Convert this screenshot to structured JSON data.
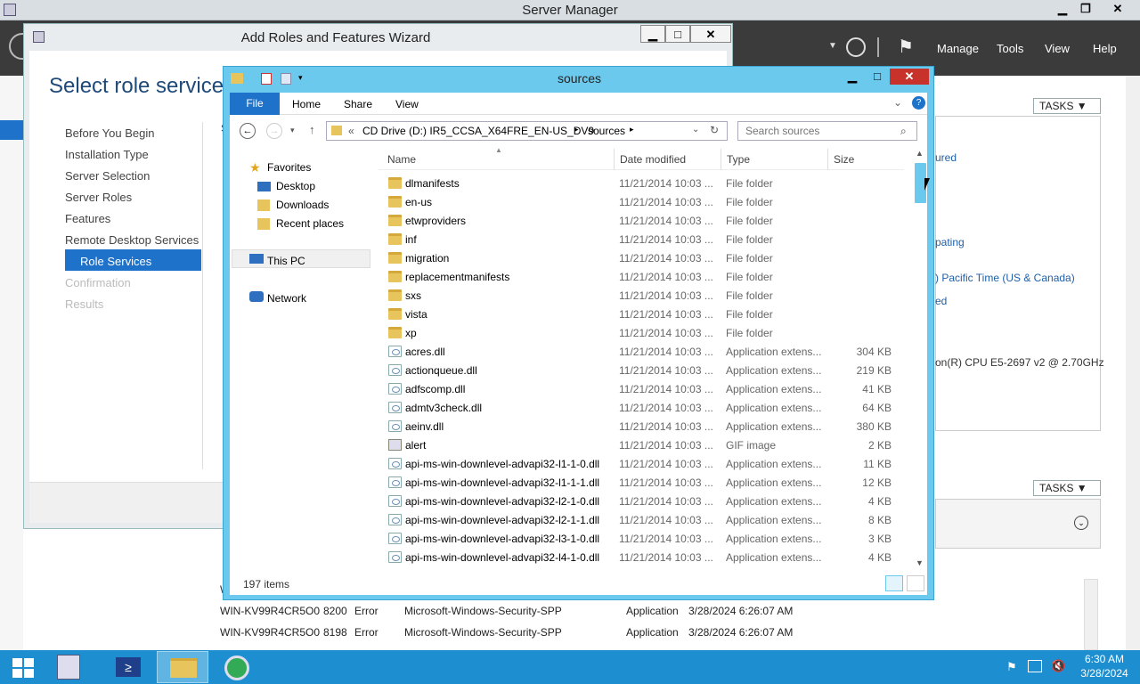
{
  "server_manager": {
    "title": "Server Manager",
    "menu": [
      "Manage",
      "Tools",
      "View",
      "Help"
    ],
    "tasks_label": "TASKS",
    "right_panel": {
      "links": [
        "ured",
        "pating",
        "ed",
        ") Pacific Time (US & Canada)"
      ],
      "cpu": "on(R) CPU E5-2697 v2 @ 2.70GHz"
    },
    "log_rows": [
      {
        "server": "WIN-KV99R4CR5O0",
        "id": "8200",
        "level": "Error",
        "source": "Microsoft-Windows-Security-SPP",
        "log": "Application",
        "time": "3/28/2024 6:26:07 AM"
      },
      {
        "server": "WIN-KV99R4CR5O0",
        "id": "8198",
        "level": "Error",
        "source": "Microsoft-Windows-Security-SPP",
        "log": "Application",
        "time": "3/28/2024 6:26:07 AM"
      }
    ],
    "partial_labels": {
      "s": "S",
      "w": "W"
    }
  },
  "wizard": {
    "title": "Add Roles and Features Wizard",
    "heading": "Select role services",
    "steps": [
      {
        "label": "Before You Begin",
        "state": "normal"
      },
      {
        "label": "Installation Type",
        "state": "normal"
      },
      {
        "label": "Server Selection",
        "state": "normal"
      },
      {
        "label": "Server Roles",
        "state": "normal"
      },
      {
        "label": "Features",
        "state": "normal"
      },
      {
        "label": "Remote Desktop Services",
        "state": "normal"
      },
      {
        "label": "Role Services",
        "state": "active"
      },
      {
        "label": "Confirmation",
        "state": "disabled"
      },
      {
        "label": "Results",
        "state": "disabled"
      }
    ]
  },
  "explorer": {
    "title": "sources",
    "ribbon_tabs": [
      "File",
      "Home",
      "Share",
      "View"
    ],
    "address": {
      "prefix": "«",
      "parts": [
        "CD Drive (D:) IR5_CCSA_X64FRE_EN-US_DV9",
        "sources"
      ]
    },
    "search_placeholder": "Search sources",
    "nav": {
      "favorites": "Favorites",
      "items": [
        "Desktop",
        "Downloads",
        "Recent places"
      ],
      "this_pc": "This PC",
      "network": "Network"
    },
    "columns": [
      "Name",
      "Date modified",
      "Type",
      "Size"
    ],
    "files": [
      {
        "name": "dlmanifests",
        "date": "11/21/2014 10:03 ...",
        "type": "File folder",
        "size": "",
        "kind": "folder"
      },
      {
        "name": "en-us",
        "date": "11/21/2014 10:03 ...",
        "type": "File folder",
        "size": "",
        "kind": "folder"
      },
      {
        "name": "etwproviders",
        "date": "11/21/2014 10:03 ...",
        "type": "File folder",
        "size": "",
        "kind": "folder"
      },
      {
        "name": "inf",
        "date": "11/21/2014 10:03 ...",
        "type": "File folder",
        "size": "",
        "kind": "folder"
      },
      {
        "name": "migration",
        "date": "11/21/2014 10:03 ...",
        "type": "File folder",
        "size": "",
        "kind": "folder"
      },
      {
        "name": "replacementmanifests",
        "date": "11/21/2014 10:03 ...",
        "type": "File folder",
        "size": "",
        "kind": "folder"
      },
      {
        "name": "sxs",
        "date": "11/21/2014 10:03 ...",
        "type": "File folder",
        "size": "",
        "kind": "folder"
      },
      {
        "name": "vista",
        "date": "11/21/2014 10:03 ...",
        "type": "File folder",
        "size": "",
        "kind": "folder"
      },
      {
        "name": "xp",
        "date": "11/21/2014 10:03 ...",
        "type": "File folder",
        "size": "",
        "kind": "folder"
      },
      {
        "name": "acres.dll",
        "date": "11/21/2014 10:03 ...",
        "type": "Application extens...",
        "size": "304 KB",
        "kind": "dll"
      },
      {
        "name": "actionqueue.dll",
        "date": "11/21/2014 10:03 ...",
        "type": "Application extens...",
        "size": "219 KB",
        "kind": "dll"
      },
      {
        "name": "adfscomp.dll",
        "date": "11/21/2014 10:03 ...",
        "type": "Application extens...",
        "size": "41 KB",
        "kind": "dll"
      },
      {
        "name": "admtv3check.dll",
        "date": "11/21/2014 10:03 ...",
        "type": "Application extens...",
        "size": "64 KB",
        "kind": "dll"
      },
      {
        "name": "aeinv.dll",
        "date": "11/21/2014 10:03 ...",
        "type": "Application extens...",
        "size": "380 KB",
        "kind": "dll"
      },
      {
        "name": "alert",
        "date": "11/21/2014 10:03 ...",
        "type": "GIF image",
        "size": "2 KB",
        "kind": "gif"
      },
      {
        "name": "api-ms-win-downlevel-advapi32-l1-1-0.dll",
        "date": "11/21/2014 10:03 ...",
        "type": "Application extens...",
        "size": "11 KB",
        "kind": "dll"
      },
      {
        "name": "api-ms-win-downlevel-advapi32-l1-1-1.dll",
        "date": "11/21/2014 10:03 ...",
        "type": "Application extens...",
        "size": "12 KB",
        "kind": "dll"
      },
      {
        "name": "api-ms-win-downlevel-advapi32-l2-1-0.dll",
        "date": "11/21/2014 10:03 ...",
        "type": "Application extens...",
        "size": "4 KB",
        "kind": "dll"
      },
      {
        "name": "api-ms-win-downlevel-advapi32-l2-1-1.dll",
        "date": "11/21/2014 10:03 ...",
        "type": "Application extens...",
        "size": "8 KB",
        "kind": "dll"
      },
      {
        "name": "api-ms-win-downlevel-advapi32-l3-1-0.dll",
        "date": "11/21/2014 10:03 ...",
        "type": "Application extens...",
        "size": "3 KB",
        "kind": "dll"
      },
      {
        "name": "api-ms-win-downlevel-advapi32-l4-1-0.dll",
        "date": "11/21/2014 10:03 ...",
        "type": "Application extens...",
        "size": "4 KB",
        "kind": "dll"
      }
    ],
    "status": "197 items"
  },
  "taskbar": {
    "time": "6:30 AM",
    "date": "3/28/2024"
  },
  "colors": {
    "accent": "#1f72c9",
    "explorer_frame": "#6bc9ed",
    "taskbar": "#1d8fd1",
    "active_step": "#1f72c9"
  }
}
